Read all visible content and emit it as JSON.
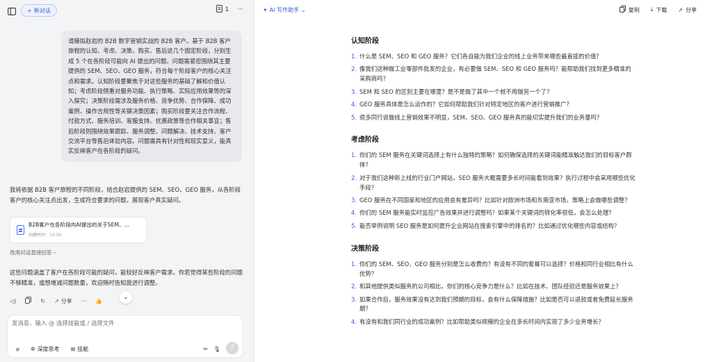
{
  "left": {
    "new_chat": "新对话",
    "page_count": "1",
    "more": "···",
    "user_message": "请模拟赵岩的 B2B 数字营销实战的 B2B 客户。基于 B2B 客户旅程的认知、考虑、决策、购买、售后这几个固定阶段，分别生成 5 个在各阶段可能向 AI 提出的问题。问题需紧密围绕其主要提供的 SEM、SEO、GEO 服务，符合每个阶段客户的核心关注点和需求。认知阶段要聚焦于对这些服务的基础了解和价值认知；考虑阶段侧重对服务功能、执行策略、实际应用效果等的深入探究；决策阶段需涉及服务价格、竞争优势、合作保障、成功案例、操作合规性等关键决策因素；购买阶段要关注合作流程、付款方式、服务培训、客服支持、优惠政策等合作相关事宜；售后阶段则围绕效果跟踪、服务调整、问题解决、技术支持、客户交流平台等售后体验内容。问题需具有针对性和现实意义，能真实反映客户在各阶段的疑问。",
    "ai_intro": "我将依据 B2B 客户旅程的不同阶段，结合赵岩提供的 SEM、SEO、GEO 服务，从各阶段客户的核心关注点出发，生成符合要求的问题，展现客户真实疑问。",
    "file_title": "B2B客户在各阶段向AI提出的关于SEM、...",
    "file_meta": "创建时间：10:50",
    "direct_answer": "改用对话直接回答",
    "ai_outro": "这些问题涵盖了客户在各阶段可能的疑问，能较好反映客户需求。你若觉得某些阶段的问题不够精准，或想增减问题数量，欢迎随时告知我进行调整。",
    "share": "分享",
    "composer_placeholder": "发消息、输入 @ 选择技能或 / 选择文件",
    "deep_think": "深度思考",
    "skills": "技能"
  },
  "right": {
    "writer": "AI 写作助手",
    "copy": "复制",
    "download": "下载",
    "share": "分享",
    "sections": [
      {
        "title": "认知阶段",
        "questions": [
          {
            "num": "1.",
            "text": "什么是 SEM、SEO 和 GEO 服务？它们各自能为我们企业的线上业务带来哪些最直接的价值？"
          },
          {
            "num": "2.",
            "text": "像我们这种做工业零部件批发的企业，有必要做 SEM、SEO 和 GEO 服务吗？能帮助我们找到更多精准的采购商吗？"
          },
          {
            "num": "3.",
            "text": "SEM 和 SEO 的区别主要在哪里？是不是做了其中一个就不用做另一个了？"
          },
          {
            "num": "4.",
            "text": "GEO 服务具体是怎么运作的？它如何帮助我们针对特定地区的客户进行营销推广？"
          },
          {
            "num": "5.",
            "text": "很多同行说做线上营销效果不明显，SEM、SEO、GEO 服务真的能切实提升我们的业务量吗？"
          }
        ]
      },
      {
        "title": "考虑阶段",
        "questions": [
          {
            "num": "1.",
            "text": "你们的 SEM 服务在关键词选择上有什么独特的策略？如何确保选择的关键词能精准触达我们的目标客户群体？"
          },
          {
            "num": "2.",
            "text": "对于我们这种新上线的行业门户网站，SEO 服务大概需要多长时间能看到效果？执行过程中会采用哪些优化手段？"
          },
          {
            "num": "3.",
            "text": "GEO 服务在不同国家和地区的应用会有差异吗？比如针对欧洲市场和东南亚市场，策略上会做哪些调整？"
          },
          {
            "num": "4.",
            "text": "你们的 SEM 服务能实时监控广告效果并进行调整吗？如果某个关键词的转化率很低，会怎么处理？"
          },
          {
            "num": "5.",
            "text": "能否举例说明 SEO 服务是如何提升企业网站在搜索引擎中的排名的？比如通过优化哪些内容或结构？"
          }
        ]
      },
      {
        "title": "决策阶段",
        "questions": [
          {
            "num": "1.",
            "text": "你们的 SEM、SEO、GEO 服务分别是怎么收费的？有没有不同的套餐可以选择？价格和同行业相比有什么优势？"
          },
          {
            "num": "2.",
            "text": "和其他提供类似服务的公司相比，你们的核心竞争力是什么？比如在技术、团队经验还是服务效果上？"
          },
          {
            "num": "3.",
            "text": "如果合作后，服务效果没有达到我们预期的目标，会有什么保障措施？比如是否可以退款或者免费延长服务期？"
          },
          {
            "num": "4.",
            "text": "有没有和我们同行业的成功案例？比如帮助类似规模的企业在多长时间内实现了多少业务增长？"
          }
        ]
      }
    ]
  }
}
